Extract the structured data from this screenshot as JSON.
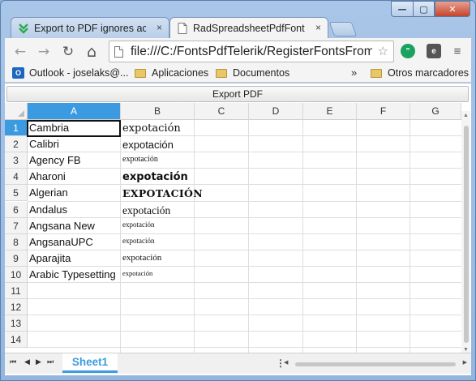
{
  "window": {
    "minimize": "—",
    "maximize": "▢",
    "close": "✕"
  },
  "tabs": [
    {
      "label": "Export to PDF ignores acc",
      "close": "×"
    },
    {
      "label": "RadSpreadsheetPdfFontsE",
      "close": "×"
    }
  ],
  "toolbar": {
    "back": "←",
    "forward": "→",
    "reload": "↻",
    "home": "⌂",
    "url": "file:///C:/FontsPdfTelerik/RegisterFontsFrom",
    "star": "☆",
    "menu": "≡"
  },
  "bookmarks": [
    {
      "label": "Outlook - joselaks@..."
    },
    {
      "label": "Aplicaciones"
    },
    {
      "label": "Documentos"
    }
  ],
  "bookmarks_overflow": "»",
  "bookmarks_other": "Otros marcadores",
  "app": {
    "export_button": "Export PDF"
  },
  "sheet": {
    "columns": [
      "A",
      "B",
      "C",
      "D",
      "E",
      "F",
      "G"
    ],
    "rows": [
      "1",
      "2",
      "3",
      "4",
      "5",
      "6",
      "7",
      "8",
      "9",
      "10",
      "11",
      "12",
      "13",
      "14"
    ],
    "fonts": [
      "Cambria",
      "Calibri",
      "Agency FB",
      "Aharoni",
      "Algerian",
      "Andalus",
      "Angsana New",
      "AngsanaUPC",
      "Aparajita",
      "Arabic Typesetting"
    ],
    "sample": [
      "expotación",
      "expotación",
      "expotación",
      "expotación",
      "EXPOTACIÓN",
      "expotación",
      "expotación",
      "expotación",
      "expotación",
      "expotación"
    ],
    "tab_name": "Sheet1"
  },
  "scroll": {
    "first": "⏮",
    "prev": "◀",
    "next": "▶",
    "last": "⏭",
    "dots": "⋮"
  }
}
